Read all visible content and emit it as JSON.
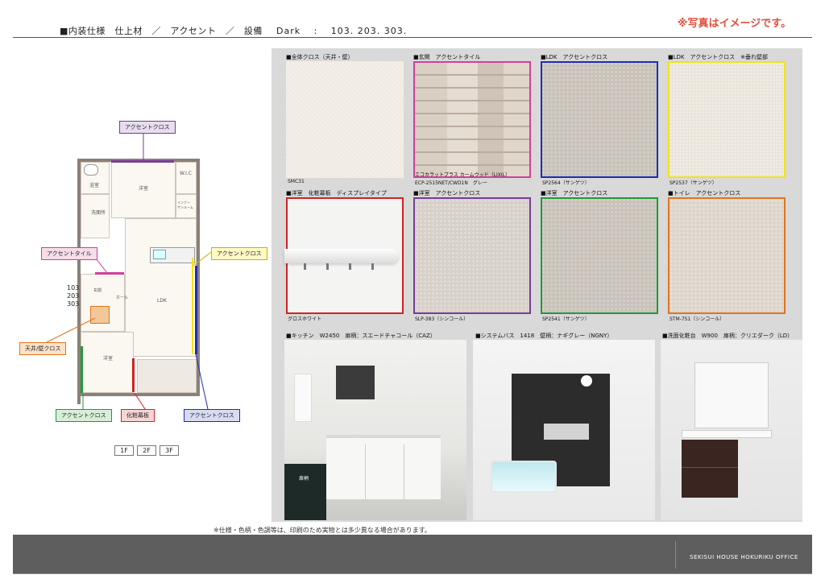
{
  "header": {
    "title": "■内装仕様　仕上材　／　アクセント　／　設備",
    "model": "Dark　 :　 103. 203. 303.",
    "note": "※写真はイメージです。"
  },
  "plan": {
    "callouts": {
      "top": "アクセントクロス",
      "tile": "アクセントタイル",
      "right": "アクセントクロス",
      "ceiling": "天井/壁クロス",
      "green": "アクセントクロス",
      "red": "化粧幕板",
      "blue": "アクセントクロス"
    },
    "units": [
      "103",
      "203",
      "303"
    ],
    "rooms": {
      "bath": "浴室",
      "western_top": "洋室",
      "wash": "洗面所",
      "wic": "W.I.C",
      "shelf": "インナー\nサンルーム",
      "ldk": "LDK",
      "entrance": "玄関",
      "hall": "ホール",
      "western_bottom": "洋室"
    },
    "floors": [
      "1F",
      "2F",
      "3F"
    ]
  },
  "swatches": [
    {
      "label": "■全体クロス（天井・壁）",
      "code": "SMC31",
      "border": "",
      "tex": "tex1"
    },
    {
      "label": "■玄関　アクセントタイル",
      "code": "ECP-2515NET/CWD1N　グレー",
      "extra": "エコカラットプラス カームウッド（LIXIL）",
      "border": "#d23f9a",
      "tex": "tile"
    },
    {
      "label": "■LDK　アクセントクロス",
      "code": "SP2564（サンゲツ）",
      "border": "#1f2bb3",
      "tex": "tex-gray"
    },
    {
      "label": "■LDK　アクセントクロス　※垂れ壁部",
      "code": "SP2537（サンゲツ）",
      "border": "#f2e317",
      "tex": "tex-light"
    },
    {
      "label": "■洋室　化粧幕板　ディスプレイタイプ",
      "code": "グロスホワイト",
      "border": "#d22222",
      "tex": "hanger"
    },
    {
      "label": "■洋室　アクセントクロス",
      "code": "SLP-383（シンコール）",
      "border": "#7a3b9a",
      "tex": "tex-beige"
    },
    {
      "label": "■洋室　アクセントクロス",
      "code": "SP2541（サンゲツ）",
      "border": "#1e9a3c",
      "tex": "tex-gray"
    },
    {
      "label": "■トイレ　アクセントクロス",
      "code": "STM-751（シンコール）",
      "border": "#e2741f",
      "tex": "tex-warm"
    }
  ],
  "equipment": {
    "kitchen": {
      "label": "■キッチン　W2450　扉柄：スエードチャコール（CAZ）",
      "sample": "扉柄"
    },
    "bath": {
      "label": "■システムバス　1418　壁柄：ナギグレー（NGNY）"
    },
    "vanity": {
      "label": "■洗面化粧台　W900　扉柄：クリエダーク（LD）"
    }
  },
  "footer": {
    "note": "※仕様・色柄・色調等は、印刷のため実物とは多少異なる場合があります。",
    "company": "SEKISUI HOUSE HOKURIKU OFFICE"
  },
  "colors": {
    "accent_note": "#e0503c",
    "purple": "#7a3b9a",
    "pink": "#d23f9a",
    "yellow": "#f2e317",
    "orange": "#e2741f",
    "green": "#1e9a3c",
    "red": "#d22222",
    "blue": "#1f2bb3"
  }
}
